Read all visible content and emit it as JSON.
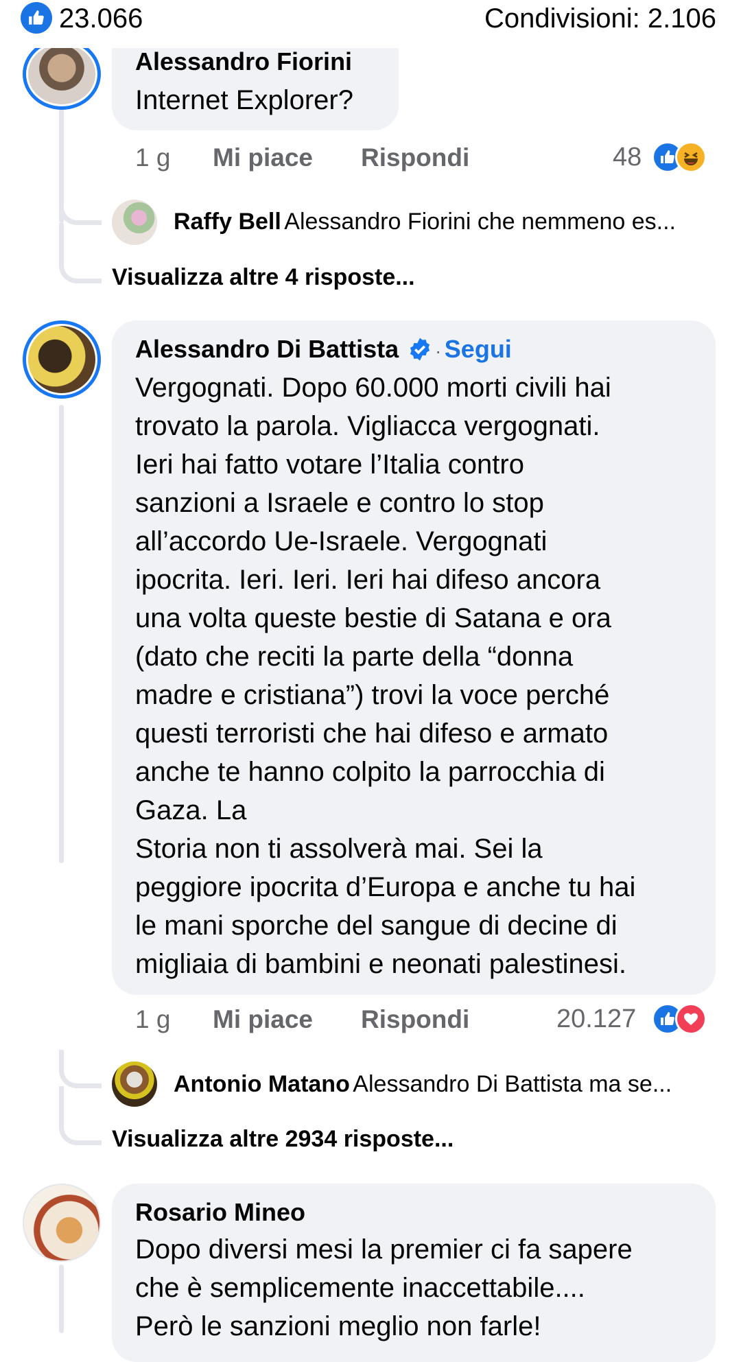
{
  "header": {
    "likes_count": "23.066",
    "shares": "Condivisioni: 2.106"
  },
  "comments": [
    {
      "author": "Alessandro Fiorini",
      "text": "Internet Explorer?",
      "time": "1 g",
      "like_label": "Mi piace",
      "reply_label": "Rispondi",
      "reactions_count": "48",
      "reactions": [
        "like-icon",
        "haha-icon"
      ],
      "reply_preview": {
        "author": "Raffy Bell",
        "text": "Alessandro Fiorini che nemmeno es..."
      },
      "more_replies": "Visualizza altre 4 risposte..."
    },
    {
      "author": "Alessandro Di Battista",
      "verified": true,
      "follow_sep": "·",
      "follow_label": "Segui",
      "text": "Vergognati. Dopo 60.000 morti civili hai\ntrovato la parola. Vigliacca vergognati.\nIeri hai fatto votare l’Italia contro\nsanzioni a Israele e contro lo stop\nall’accordo Ue-Israele. Vergognati\nipocrita. Ieri. Ieri. Ieri hai difeso ancora\nuna volta queste bestie di Satana e ora\n(dato che reciti la parte della “donna\nmadre e cristiana”) trovi la voce perché\nquesti terroristi che hai difeso e armato\nanche te hanno colpito la parrocchia di\nGaza. La\nStoria non ti assolverà mai. Sei la\npeggiore ipocrita d’Europa e anche tu hai\nle mani sporche del sangue di decine di\nmigliaia di bambini e neonati palestinesi.",
      "time": "1 g",
      "like_label": "Mi piace",
      "reply_label": "Rispondi",
      "reactions_count": "20.127",
      "reactions": [
        "like-icon",
        "love-icon"
      ],
      "reply_preview": {
        "author": "Antonio Matano",
        "text": "Alessandro Di Battista ma se..."
      },
      "more_replies": "Visualizza altre 2934 risposte..."
    },
    {
      "author": "Rosario Mineo",
      "text": "Dopo diversi mesi la premier ci fa sapere\nche è semplicemente inaccettabile....\nPerò le sanzioni meglio non farle!"
    }
  ],
  "colors": {
    "accent": "#1877f2",
    "bubble": "#f0f2f5",
    "thread_line": "#e4e6eb",
    "meta_text": "#65676b",
    "love": "#f33e58",
    "haha": "#f7b125"
  }
}
